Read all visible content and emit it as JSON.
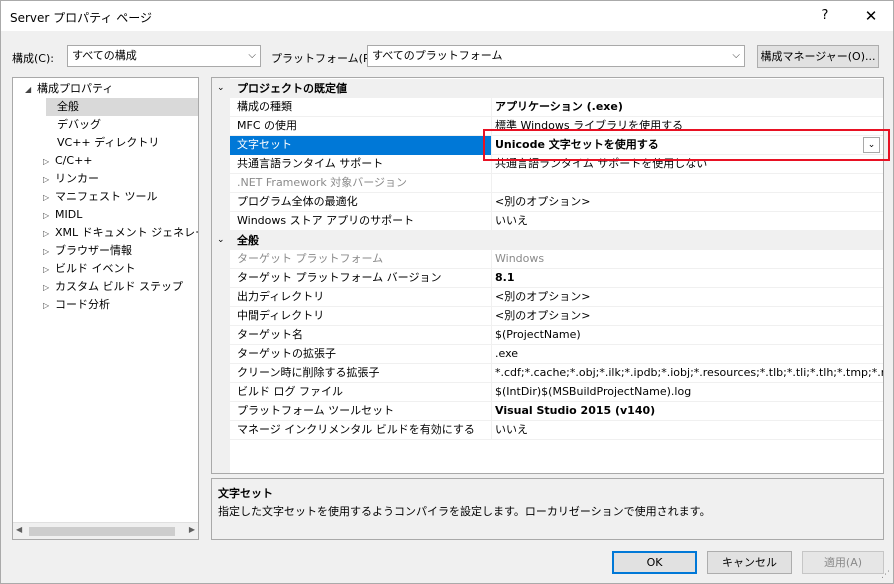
{
  "window": {
    "title": "Server プロパティ ページ",
    "help": "?",
    "close": "✕"
  },
  "toolbar": {
    "config_label": "構成(C):",
    "config_value": "すべての構成",
    "platform_label": "プラットフォーム(P):",
    "platform_value": "すべてのプラットフォーム",
    "config_manager": "構成マネージャー(O)..."
  },
  "tree": {
    "items": [
      {
        "label": "構成プロパティ",
        "expander": "◢"
      },
      {
        "label": "全般"
      },
      {
        "label": "デバッグ"
      },
      {
        "label": "VC++ ディレクトリ"
      },
      {
        "label": "C/C++",
        "expander": "▷"
      },
      {
        "label": "リンカー",
        "expander": "▷"
      },
      {
        "label": "マニフェスト ツール",
        "expander": "▷"
      },
      {
        "label": "MIDL",
        "expander": "▷"
      },
      {
        "label": "XML ドキュメント ジェネレーター",
        "expander": "▷"
      },
      {
        "label": "ブラウザー情報",
        "expander": "▷"
      },
      {
        "label": "ビルド イベント",
        "expander": "▷"
      },
      {
        "label": "カスタム ビルド ステップ",
        "expander": "▷"
      },
      {
        "label": "コード分析",
        "expander": "▷"
      }
    ],
    "scroll_left": "◀",
    "scroll_right": "▶"
  },
  "grid": {
    "cat1": {
      "chevron": "⌄",
      "label": "プロジェクトの既定値"
    },
    "cat2": {
      "chevron": "⌄",
      "label": "全般"
    },
    "rows": [
      {
        "name": "構成の種類",
        "value": "アプリケーション (.exe)"
      },
      {
        "name": "MFC の使用",
        "value": "標準 Windows ライブラリを使用する"
      },
      {
        "name": "文字セット",
        "value": "Unicode 文字セットを使用する"
      },
      {
        "name": "共通言語ランタイム サポート",
        "value": "共通言語ランタイム サポートを使用しない"
      },
      {
        "name": ".NET Framework 対象バージョン",
        "value": ""
      },
      {
        "name": "プログラム全体の最適化",
        "value": "<別のオプション>"
      },
      {
        "name": "Windows ストア アプリのサポート",
        "value": "いいえ"
      },
      {
        "name": "ターゲット プラットフォーム",
        "value": "Windows"
      },
      {
        "name": "ターゲット プラットフォーム バージョン",
        "value": "8.1"
      },
      {
        "name": "出力ディレクトリ",
        "value": "<別のオプション>"
      },
      {
        "name": "中間ディレクトリ",
        "value": "<別のオプション>"
      },
      {
        "name": "ターゲット名",
        "value": "$(ProjectName)"
      },
      {
        "name": "ターゲットの拡張子",
        "value": ".exe"
      },
      {
        "name": "クリーン時に削除する拡張子",
        "value": "*.cdf;*.cache;*.obj;*.ilk;*.ipdb;*.iobj;*.resources;*.tlb;*.tli;*.tlh;*.tmp;*.rsp;*."
      },
      {
        "name": "ビルド ログ ファイル",
        "value": "$(IntDir)$(MSBuildProjectName).log"
      },
      {
        "name": "プラットフォーム ツールセット",
        "value": "Visual Studio 2015 (v140)"
      },
      {
        "name": "マネージ インクリメンタル ビルドを有効にする",
        "value": "いいえ"
      }
    ],
    "dropdown_arrow": "⌄"
  },
  "description": {
    "title": "文字セット",
    "text": "指定した文字セットを使用するようコンパイラを設定します。ローカリゼーションで使用されます。"
  },
  "buttons": {
    "ok": "OK",
    "cancel": "キャンセル",
    "apply": "適用(A)"
  },
  "colors": {
    "selection": "#0078d7",
    "highlight_box": "#e81123"
  }
}
